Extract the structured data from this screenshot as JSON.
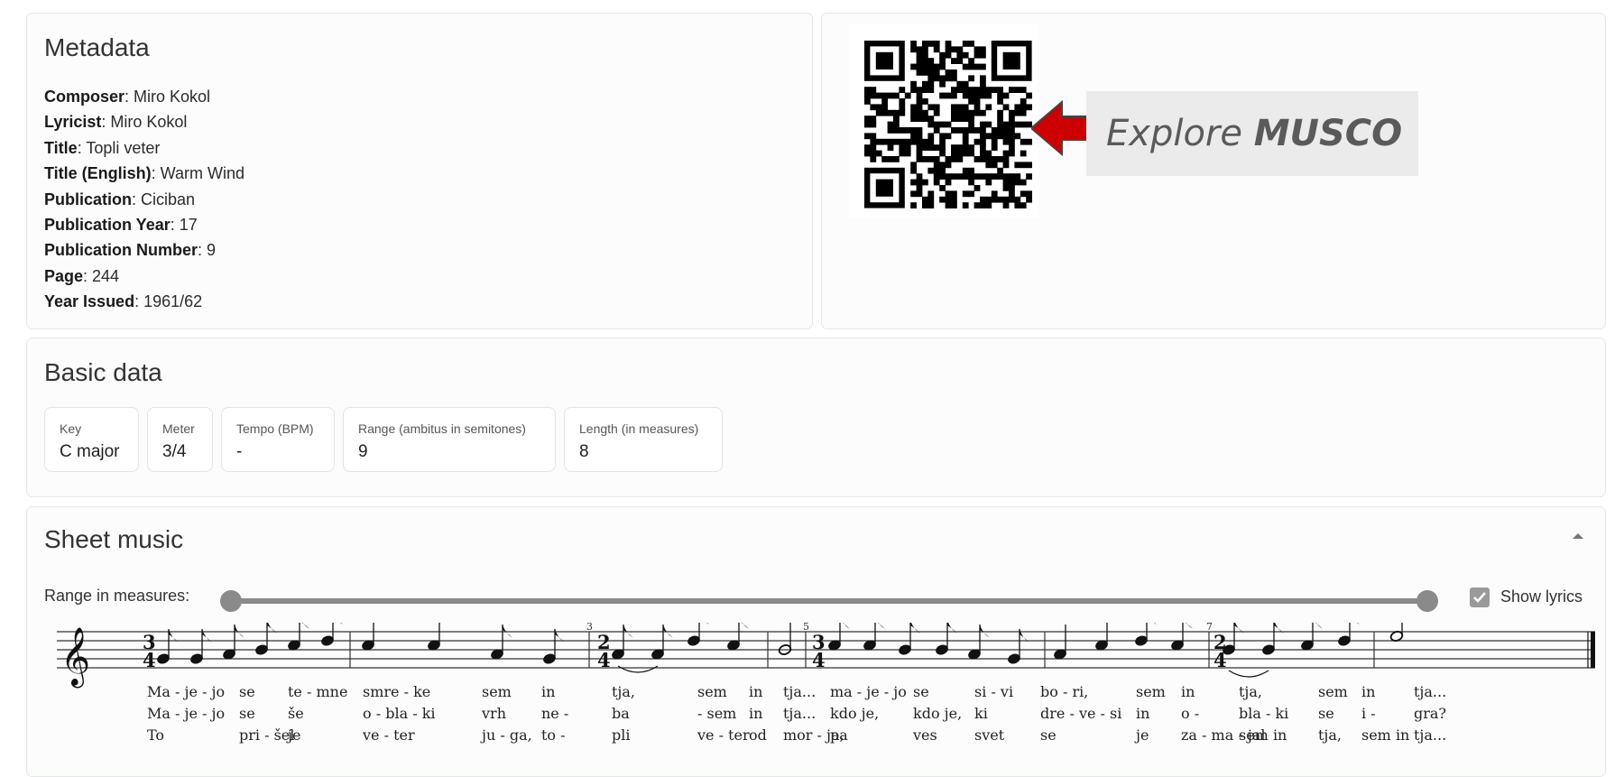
{
  "metadata": {
    "title": "Metadata",
    "fields": [
      {
        "label": "Composer",
        "value": ": Miro Kokol"
      },
      {
        "label": "Lyricist",
        "value": ": Miro Kokol"
      },
      {
        "label": "Title",
        "value": ": Topli veter"
      },
      {
        "label": "Title (English)",
        "value": ": Warm Wind"
      },
      {
        "label": "Publication",
        "value": ": Ciciban"
      },
      {
        "label": "Publication Year",
        "value": ": 17"
      },
      {
        "label": "Publication Number",
        "value": ": 9"
      },
      {
        "label": "Page",
        "value": ": 244"
      },
      {
        "label": "Year Issued",
        "value": ": 1961/62"
      }
    ]
  },
  "promo": {
    "explore": "Explore ",
    "brand": "MUSCO",
    "arrow_color": "#cc0000"
  },
  "basic": {
    "title": "Basic data",
    "stats": [
      {
        "label": "Key",
        "value": "C major"
      },
      {
        "label": "Meter",
        "value": "3/4"
      },
      {
        "label": "Tempo (BPM)",
        "value": "-"
      },
      {
        "label": "Range (ambitus in semitones)",
        "value": "9"
      },
      {
        "label": "Length (in measures)",
        "value": "8"
      }
    ]
  },
  "sheet": {
    "title": "Sheet music",
    "collapse_icon": "chevron-up-icon",
    "range_label": "Range in measures:",
    "range": {
      "min": 1,
      "max": 8,
      "low": 1,
      "high": 8
    },
    "show_lyrics_label": "Show lyrics",
    "show_lyrics_checked": true,
    "measure_numbers": [
      "3",
      "5",
      "7"
    ],
    "time_signatures": [
      "3/4",
      "2/4",
      "3/4",
      "2/4"
    ],
    "lyrics": [
      [
        "Ma - je - jo",
        "se",
        "te - mne",
        "smre - ke",
        "sem",
        "in",
        "tja,",
        "sem",
        "in",
        "tja...",
        "ma - je - jo",
        "se",
        "si - vi",
        "bo - ri,",
        "sem",
        "in",
        "tja,",
        "sem",
        "in",
        "tja..."
      ],
      [
        "Ma - je - jo",
        "se",
        "še",
        "o - bla - ki",
        "vrh",
        "ne -",
        "ba",
        "- sem",
        "in",
        "tja...",
        "kdo je,",
        "kdo je,",
        "ki",
        "dre - ve - si",
        "in",
        "o -",
        "bla - ki",
        "se",
        "i -",
        "gra?"
      ],
      [
        "To",
        "pri - šel",
        "je",
        "ve - ter",
        "ju - ga,",
        "to -",
        "pli",
        "ve - ter",
        "od",
        "mor - ja,",
        "pa",
        "ves",
        "svet",
        "se",
        "je",
        "za - ma - jal",
        "sem in",
        "tja,",
        "sem in",
        "tja..."
      ]
    ]
  }
}
